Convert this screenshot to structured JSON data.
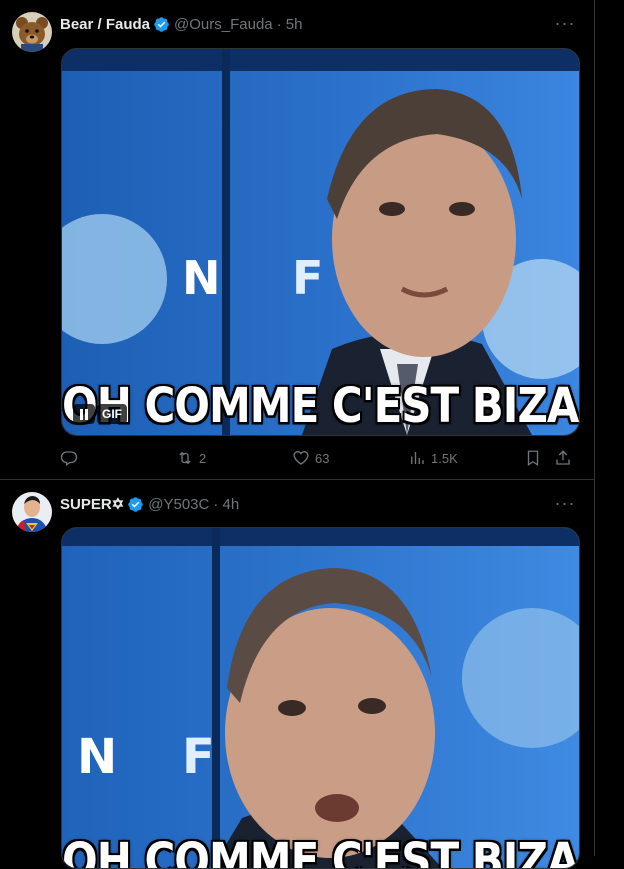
{
  "posts": [
    {
      "author": {
        "name": "Bear / Fauda",
        "handle": "@Ours_Fauda",
        "time": "· 5h",
        "verified": true
      },
      "media": {
        "type": "gif",
        "caption": "OH COMME C'EST BIZARRE",
        "badge": "GIF"
      },
      "stats": {
        "replies": "",
        "reposts": "2",
        "likes": "63",
        "views": "1.5K"
      }
    },
    {
      "author": {
        "name": "SUPER✡",
        "handle": "@Y503C",
        "time": "· 4h",
        "verified": true
      },
      "media": {
        "type": "gif",
        "caption": "OH COMME C'EST BIZARRE"
      }
    }
  ],
  "colors": {
    "background": "#000000",
    "text": "#e7e9ea",
    "muted": "#71767b",
    "verified": "#1d9bf0",
    "border": "#2f3336"
  }
}
